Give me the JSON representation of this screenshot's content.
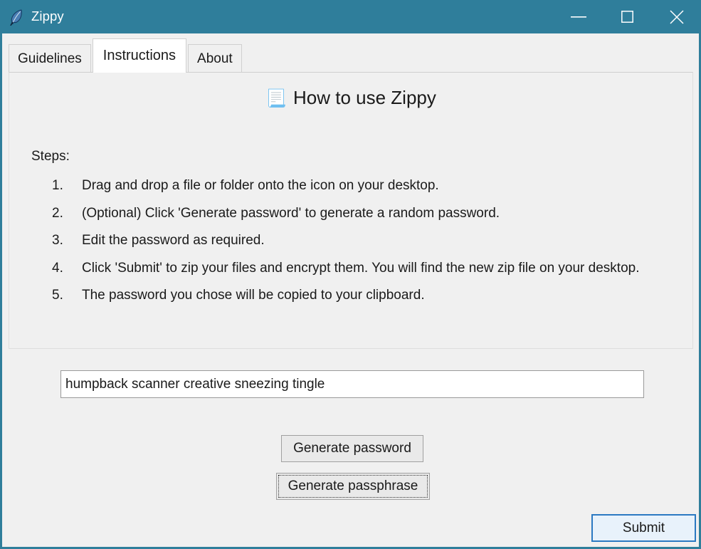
{
  "window": {
    "title": "Zippy",
    "app_icon": "feather-quill-icon",
    "titlebar_color": "#2f7e9b",
    "controls": {
      "minimize": "minimize-icon",
      "maximize": "maximize-icon",
      "close": "close-icon"
    }
  },
  "tabs": [
    {
      "label": "Guidelines",
      "active": false
    },
    {
      "label": "Instructions",
      "active": true
    },
    {
      "label": "About",
      "active": false
    }
  ],
  "panel": {
    "heading_icon": "📃",
    "heading": "How to use Zippy",
    "steps_label": "Steps:",
    "steps": [
      "Drag and drop a file or folder onto the icon on your desktop.",
      "(Optional) Click 'Generate password' to generate a random password.",
      "Edit the password as required.",
      "Click 'Submit' to zip your files and encrypt them. You will find the new zip file on your desktop.",
      "The password you chose will be copied to your clipboard."
    ]
  },
  "form": {
    "password_value": "humpback scanner creative sneezing tingle",
    "password_placeholder": "",
    "generate_password_label": "Generate password",
    "generate_passphrase_label": "Generate passphrase",
    "submit_label": "Submit",
    "submit_border_color": "#2b79c2",
    "submit_fill_color": "#e8f2fb"
  }
}
